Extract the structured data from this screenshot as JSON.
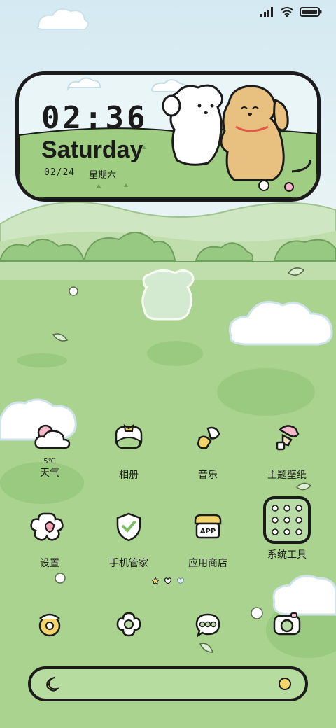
{
  "status_bar": {
    "signal_icon": "signal-bars-icon",
    "wifi_icon": "wifi-icon",
    "battery_icon": "battery-icon"
  },
  "clock_widget": {
    "time": "02:36",
    "weekday": "Saturday",
    "date": "02/24",
    "weekday_cn": "星期六"
  },
  "weather": {
    "temperature": "5℃"
  },
  "apps_row1": [
    {
      "label": "天气",
      "icon": "cloud-sun-icon"
    },
    {
      "label": "相册",
      "icon": "photo-album-icon"
    },
    {
      "label": "音乐",
      "icon": "music-note-icon"
    },
    {
      "label": "主题壁纸",
      "icon": "paint-roller-icon"
    }
  ],
  "apps_row2": [
    {
      "label": "设置",
      "icon": "gear-flower-icon"
    },
    {
      "label": "手机管家",
      "icon": "shield-check-icon"
    },
    {
      "label": "应用商店",
      "icon": "app-store-icon"
    },
    {
      "label": "系统工具",
      "icon": "tools-folder-icon"
    }
  ],
  "page_indicator": {
    "icons": [
      "star-dot-icon",
      "heart-dot-active-icon",
      "heart-dot-icon"
    ]
  },
  "dock": [
    {
      "icon": "phone-icon"
    },
    {
      "icon": "flower-contacts-icon"
    },
    {
      "icon": "message-bubble-icon"
    },
    {
      "icon": "camera-icon"
    }
  ],
  "search_bar": {
    "left_icon": "moon-icon",
    "right_icon": "circle-icon"
  },
  "colors": {
    "grass": "#a7d38c",
    "sky": "#dcedf4",
    "outline": "#1b1b1b",
    "dog": "#e8c07f"
  }
}
